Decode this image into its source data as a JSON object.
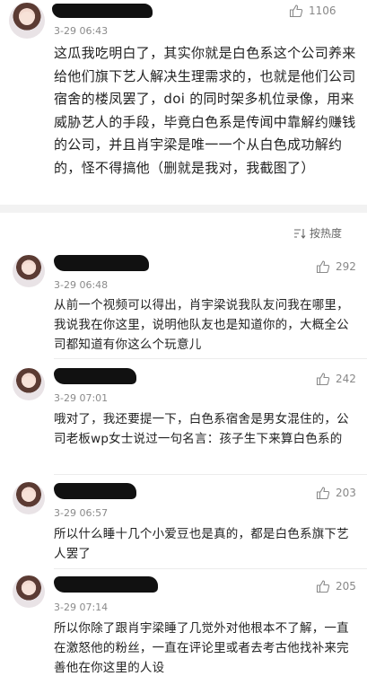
{
  "main_post": {
    "time": "3-29 06:43",
    "likes": "1106",
    "text": "这瓜我吃明白了，其实你就是白色系这个公司养来给他们旗下艺人解决生理需求的，也就是他们公司宿舍的楼凤罢了，doi 的同时架多机位录像，用来威胁艺人的手段，毕竟白色系是传闻中靠解约赚钱的公司，并且肖宇梁是唯一一个从白色成功解约的，怪不得搞他（删就是我对，我截图了）"
  },
  "sort": {
    "label": "按热度",
    "icon": "sort-icon"
  },
  "replies": [
    {
      "time": "3-29 06:48",
      "likes": "292",
      "text": "从前一个视频可以得出，肖宇梁说我队友问我在哪里，我说我在你这里，说明他队友也是知道你的，大概全公司都知道有你这么个玩意儿"
    },
    {
      "time": "3-29 07:01",
      "likes": "242",
      "text": "哦对了，我还要提一下，白色系宿舍是男女混住的，公司老板wp女士说过一句名言：孩子生下来算白色系的"
    },
    {
      "time": "3-29 06:57",
      "likes": "203",
      "text": "所以什么睡十几个小爱豆也是真的，都是白色系旗下艺人罢了"
    },
    {
      "time": "3-29 07:14",
      "likes": "205",
      "text": "所以你除了跟肖宇梁睡了几觉外对他根本不了解，一直在激怒他的粉丝，一直在评论里或者去考古他找补来完善他在你这里的人设"
    }
  ],
  "colors": {
    "text": "#222222",
    "meta": "#8a8a8a",
    "divider": "#f2f2f2"
  }
}
